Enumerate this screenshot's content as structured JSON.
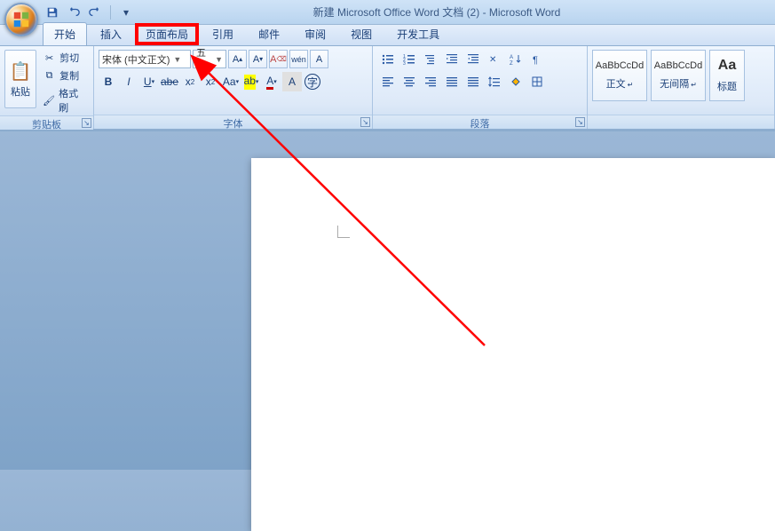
{
  "title": "新建 Microsoft Office Word 文档 (2) - Microsoft Word",
  "tabs": {
    "home": "开始",
    "insert": "插入",
    "layout": "页面布局",
    "refs": "引用",
    "mail": "邮件",
    "review": "审阅",
    "view": "视图",
    "dev": "开发工具"
  },
  "clipboard": {
    "paste": "粘贴",
    "cut": "剪切",
    "copy": "复制",
    "fmtpainter": "格式刷",
    "group": "剪贴板"
  },
  "font": {
    "name": "宋体 (中文正文)",
    "size": "五号",
    "group": "字体"
  },
  "para": {
    "group": "段落"
  },
  "styles": {
    "preview": "AaBbCcDd",
    "normal": "正文",
    "nogap": "无间隔",
    "heading1_abbr": "标题",
    "bigA": "Aa"
  }
}
